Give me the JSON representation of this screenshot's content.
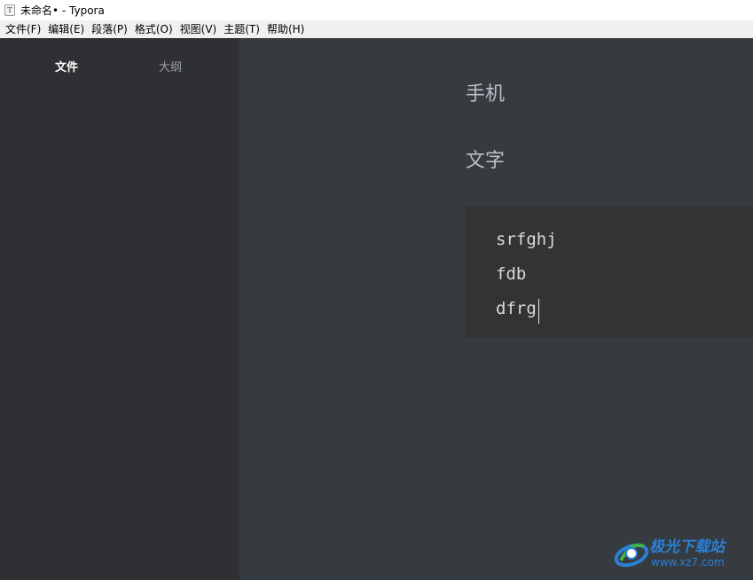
{
  "window": {
    "icon_letter": "T",
    "title": "未命名• - Typora"
  },
  "menu": [
    {
      "label": "文件(F)"
    },
    {
      "label": "编辑(E)"
    },
    {
      "label": "段落(P)"
    },
    {
      "label": "格式(O)"
    },
    {
      "label": "视图(V)"
    },
    {
      "label": "主题(T)"
    },
    {
      "label": "帮助(H)"
    }
  ],
  "sidebar": {
    "tabs": [
      {
        "label": "文件",
        "active": true
      },
      {
        "label": "大纲",
        "active": false
      }
    ]
  },
  "editor": {
    "headings": [
      "手机",
      "文字"
    ],
    "code_lines": [
      "srfghj",
      "fdb",
      "dfrg"
    ]
  },
  "watermark": {
    "title": "极光下载站",
    "url": "www.xz7.com"
  },
  "colors": {
    "sidebar_bg": "#2e3033",
    "editor_bg": "#363b40",
    "code_bg": "#333333",
    "watermark": "#2a7fd6"
  }
}
